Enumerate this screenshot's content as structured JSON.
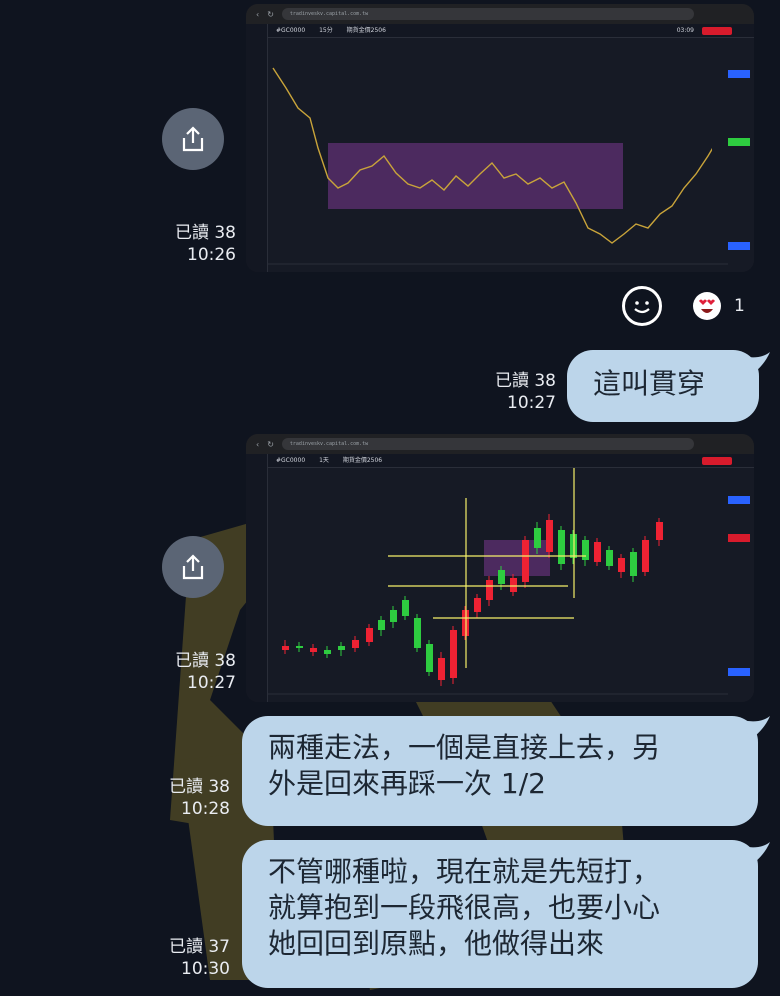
{
  "messages": [
    {
      "type": "image",
      "read_label": "已讀 38",
      "time": "10:26",
      "chart": {
        "url": "tradinveskv.capital.com.tw",
        "symbol": "#GC0000",
        "interval": "15分",
        "title": "期貨金價2506",
        "time_readout": "03:09"
      },
      "reactions": {
        "count": "1"
      }
    },
    {
      "type": "text",
      "outgoing": true,
      "read_label": "已讀 38",
      "time": "10:27",
      "text": "這叫貫穿"
    },
    {
      "type": "image",
      "read_label": "已讀 38",
      "time": "10:27",
      "chart": {
        "url": "tradinveskv.capital.com.tw",
        "symbol": "#GC0000",
        "interval": "1天",
        "title": "期貨金價2506"
      }
    },
    {
      "type": "text",
      "outgoing": true,
      "read_label": "已讀 38",
      "time": "10:28",
      "lines": [
        "兩種走法，一個是直接上去，另",
        "外是回來再踩一次 1/2"
      ]
    },
    {
      "type": "text",
      "outgoing": true,
      "read_label": "已讀 37",
      "time": "10:30",
      "lines": [
        "不管哪種啦，現在就是先短打，",
        "就算抱到一段飛很高，也要小心",
        "她回回到原點，他做得出來"
      ]
    }
  ],
  "colors": {
    "background": "#0f141f",
    "bubble": "#bcd5ea",
    "bubble_text": "#1d2733",
    "share_button": "#5b6575",
    "candle_up": "#2ecc40",
    "candle_down": "#ee2233",
    "guide_line": "#f5f06a",
    "zone": "#5a2e6e"
  },
  "icons": [
    "share-icon",
    "smile-icon",
    "heart-eyes-emoji"
  ]
}
